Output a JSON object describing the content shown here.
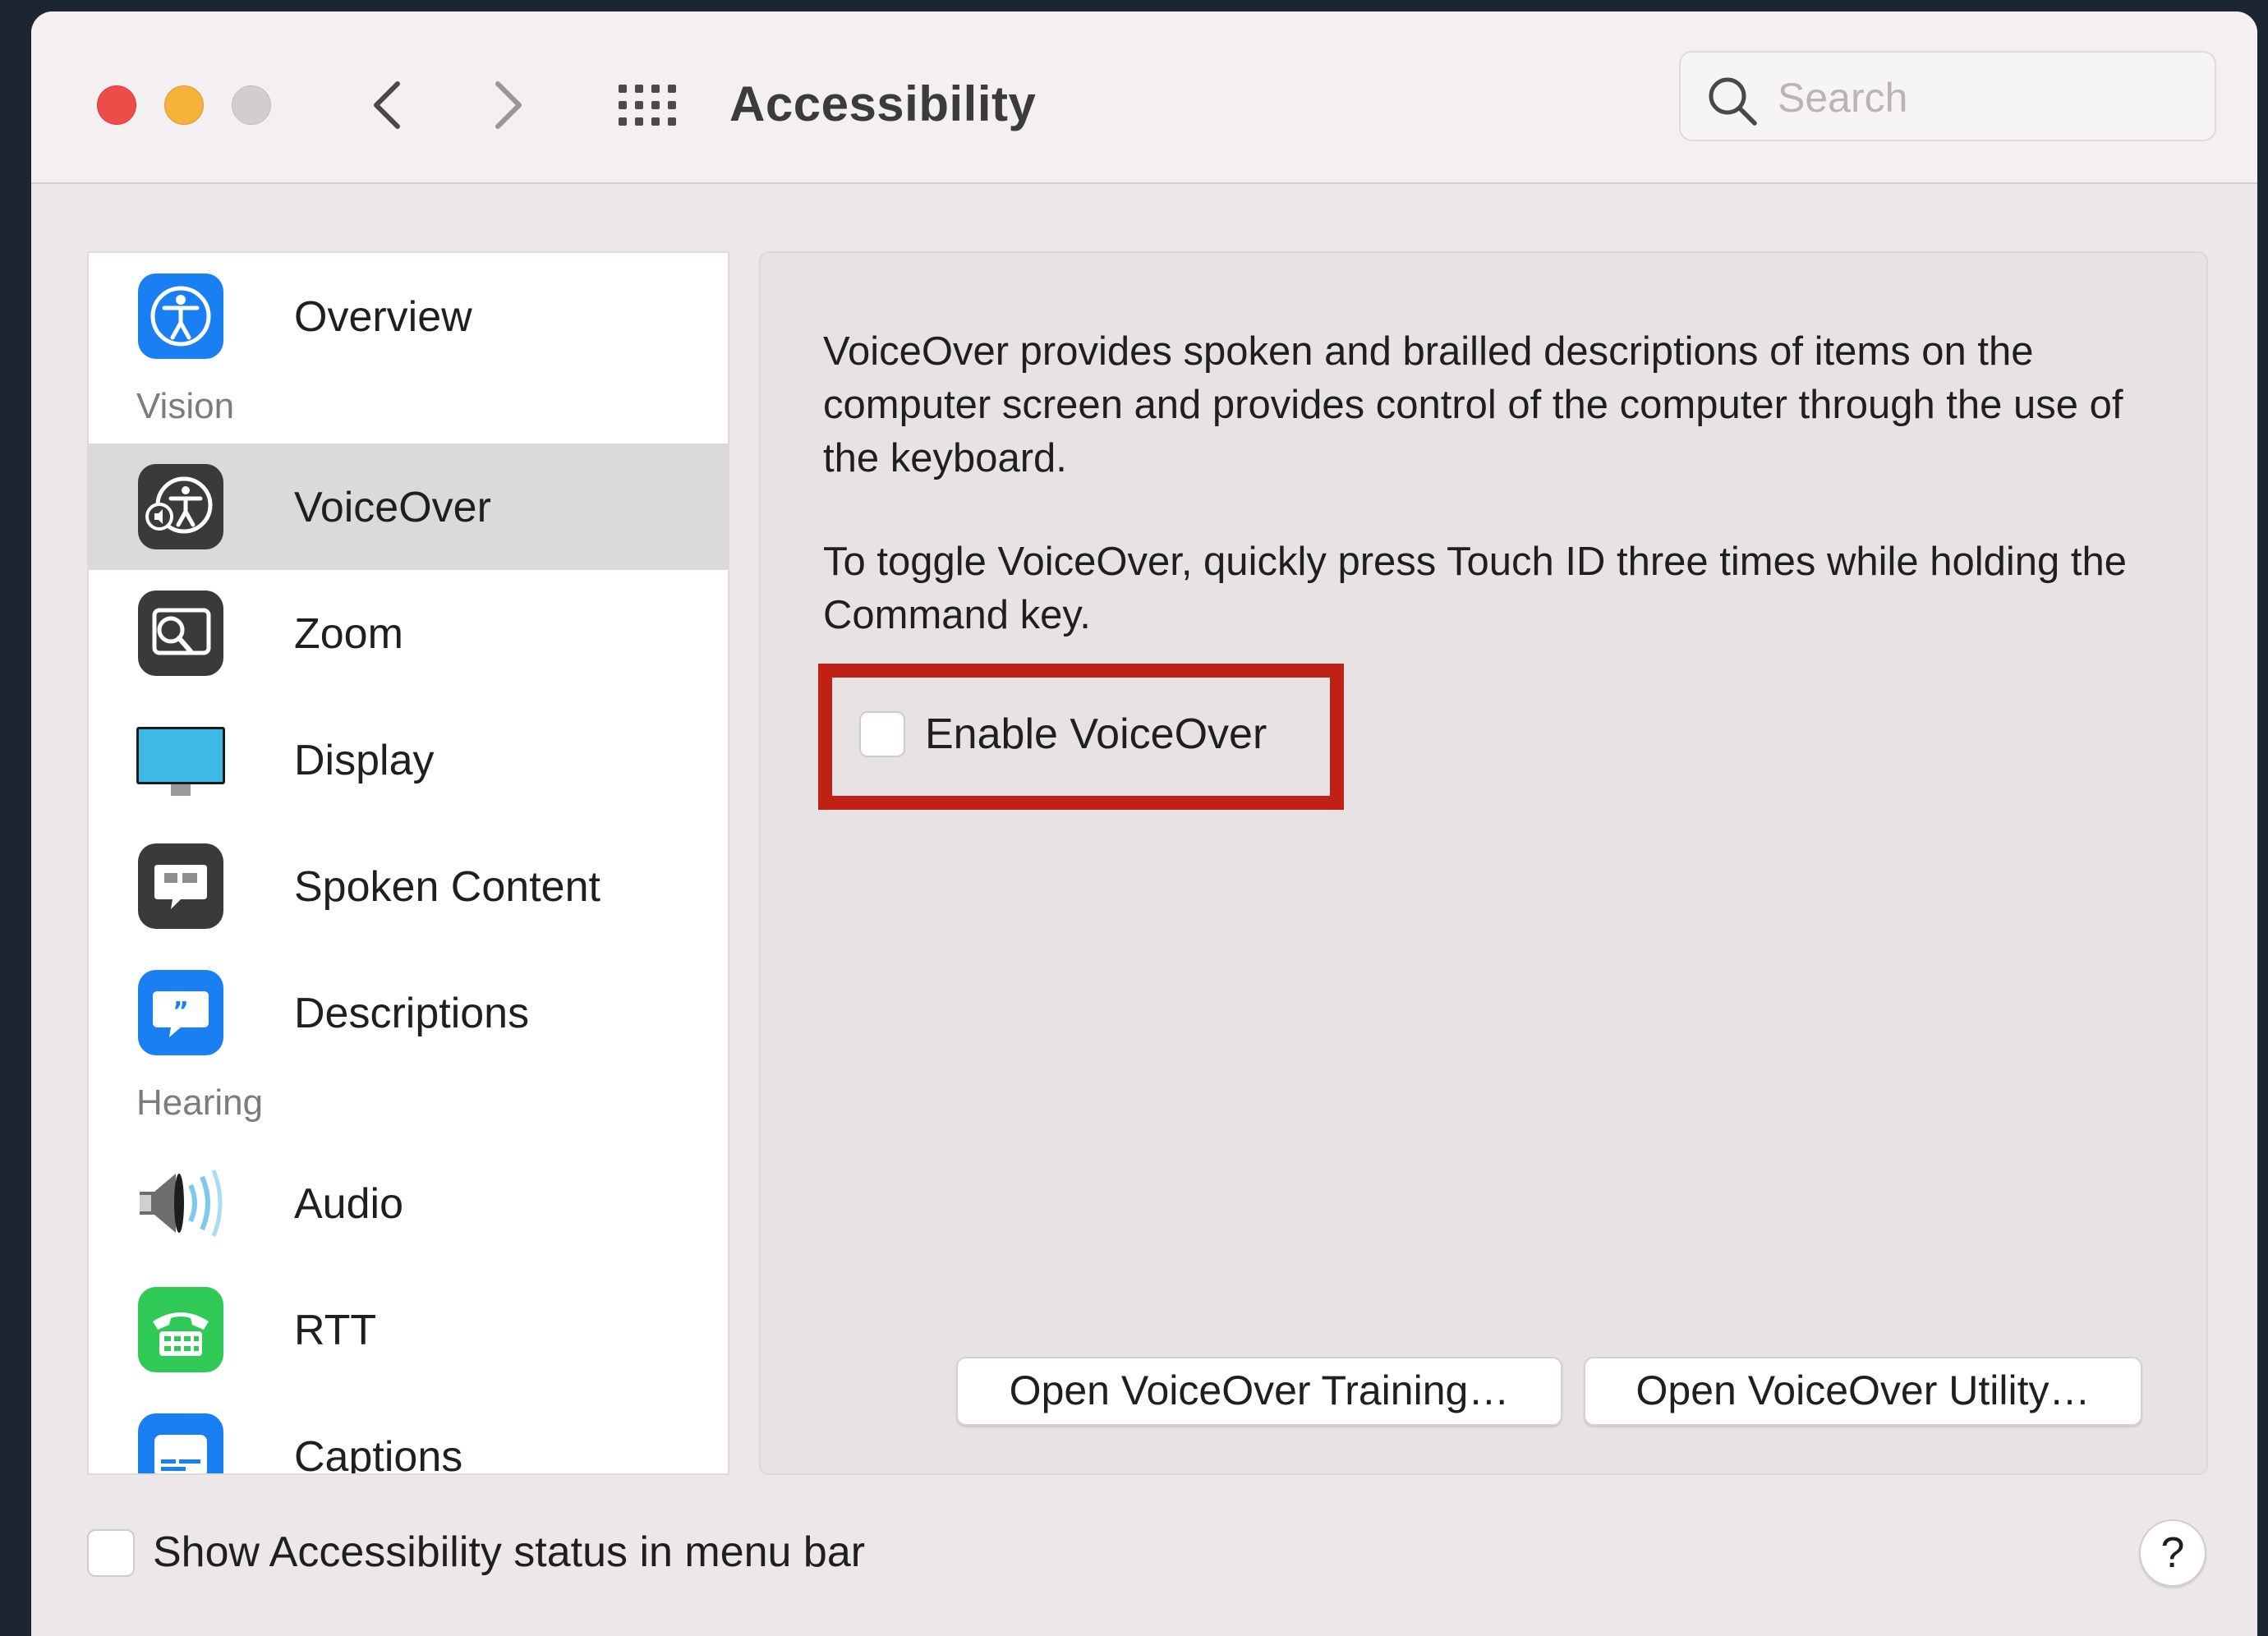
{
  "window": {
    "title": "Accessibility",
    "search": {
      "placeholder": "Search",
      "value": ""
    }
  },
  "sidebar": {
    "items": [
      {
        "label": "Overview",
        "icon": "accessibility-person-icon"
      },
      {
        "section": "Vision"
      },
      {
        "label": "VoiceOver",
        "icon": "voiceover-icon",
        "selected": true
      },
      {
        "label": "Zoom",
        "icon": "zoom-icon"
      },
      {
        "label": "Display",
        "icon": "display-icon"
      },
      {
        "label": "Spoken Content",
        "icon": "spoken-content-icon"
      },
      {
        "label": "Descriptions",
        "icon": "descriptions-icon"
      },
      {
        "section": "Hearing"
      },
      {
        "label": "Audio",
        "icon": "speaker-icon"
      },
      {
        "label": "RTT",
        "icon": "rtt-phone-icon"
      },
      {
        "label": "Captions",
        "icon": "captions-icon"
      }
    ]
  },
  "pane": {
    "description": "VoiceOver provides spoken and brailled descriptions of items on the computer screen and provides control of the computer through the use of the keyboard.",
    "toggle_hint": "To toggle VoiceOver, quickly press Touch ID three times while holding the Command key.",
    "enable_label": "Enable VoiceOver",
    "enable_checked": false,
    "buttons": {
      "training": "Open VoiceOver Training…",
      "utility": "Open VoiceOver Utility…"
    }
  },
  "footer": {
    "status_label": "Show Accessibility status in menu bar",
    "status_checked": false,
    "help_label": "?"
  },
  "colors": {
    "highlight": "#c02114",
    "selection": "#dcd9da",
    "accent_blue": "#1a7ff2"
  }
}
